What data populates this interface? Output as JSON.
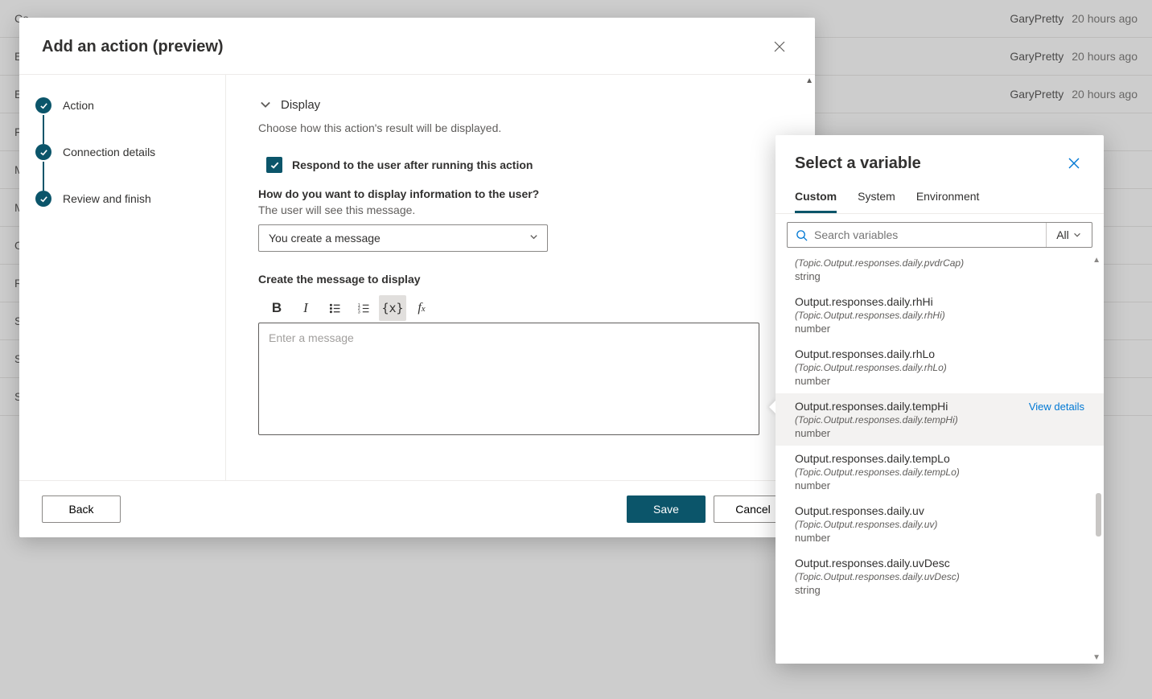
{
  "background": {
    "rows": [
      {
        "label": "Co",
        "author": "GaryPretty",
        "time": "20 hours ago"
      },
      {
        "label": "En",
        "author": "GaryPretty",
        "time": "20 hours ago"
      },
      {
        "label": "Esc",
        "author": "GaryPretty",
        "time": "20 hours ago"
      },
      {
        "label": "Fall",
        "author": "",
        "time": ""
      },
      {
        "label": "MS",
        "author": "",
        "time": ""
      },
      {
        "label": "Mu",
        "author": "",
        "time": ""
      },
      {
        "label": "On",
        "author": "",
        "time": ""
      },
      {
        "label": "Re",
        "author": "",
        "time": ""
      },
      {
        "label": "Sig",
        "author": "",
        "time": ""
      },
      {
        "label": "Sto",
        "author": "",
        "time": ""
      },
      {
        "label": "Sto",
        "author": "",
        "time": ""
      }
    ]
  },
  "modal": {
    "title": "Add an action (preview)",
    "steps": [
      {
        "label": "Action"
      },
      {
        "label": "Connection details"
      },
      {
        "label": "Review and finish"
      }
    ],
    "display": {
      "section_title": "Display",
      "section_desc": "Choose how this action's result will be displayed.",
      "respond_checkbox_label": "Respond to the user after running this action",
      "question_label": "How do you want to display information to the user?",
      "question_sub": "The user will see this message.",
      "select_value": "You create a message",
      "create_label": "Create the message to display",
      "editor_placeholder": "Enter a message"
    },
    "footer": {
      "back": "Back",
      "save": "Save",
      "cancel": "Cancel"
    }
  },
  "var_panel": {
    "title": "Select a variable",
    "tabs": {
      "custom": "Custom",
      "system": "System",
      "environment": "Environment"
    },
    "search_placeholder": "Search variables",
    "filter_label": "All",
    "items": [
      {
        "name": "",
        "path": "(Topic.Output.responses.daily.pvdrCap)",
        "type": "string",
        "partial": true
      },
      {
        "name": "Output.responses.daily.rhHi",
        "path": "(Topic.Output.responses.daily.rhHi)",
        "type": "number"
      },
      {
        "name": "Output.responses.daily.rhLo",
        "path": "(Topic.Output.responses.daily.rhLo)",
        "type": "number"
      },
      {
        "name": "Output.responses.daily.tempHi",
        "path": "(Topic.Output.responses.daily.tempHi)",
        "type": "number",
        "selected": true,
        "view_details": "View details"
      },
      {
        "name": "Output.responses.daily.tempLo",
        "path": "(Topic.Output.responses.daily.tempLo)",
        "type": "number"
      },
      {
        "name": "Output.responses.daily.uv",
        "path": "(Topic.Output.responses.daily.uv)",
        "type": "number"
      },
      {
        "name": "Output.responses.daily.uvDesc",
        "path": "(Topic.Output.responses.daily.uvDesc)",
        "type": "string"
      }
    ]
  }
}
